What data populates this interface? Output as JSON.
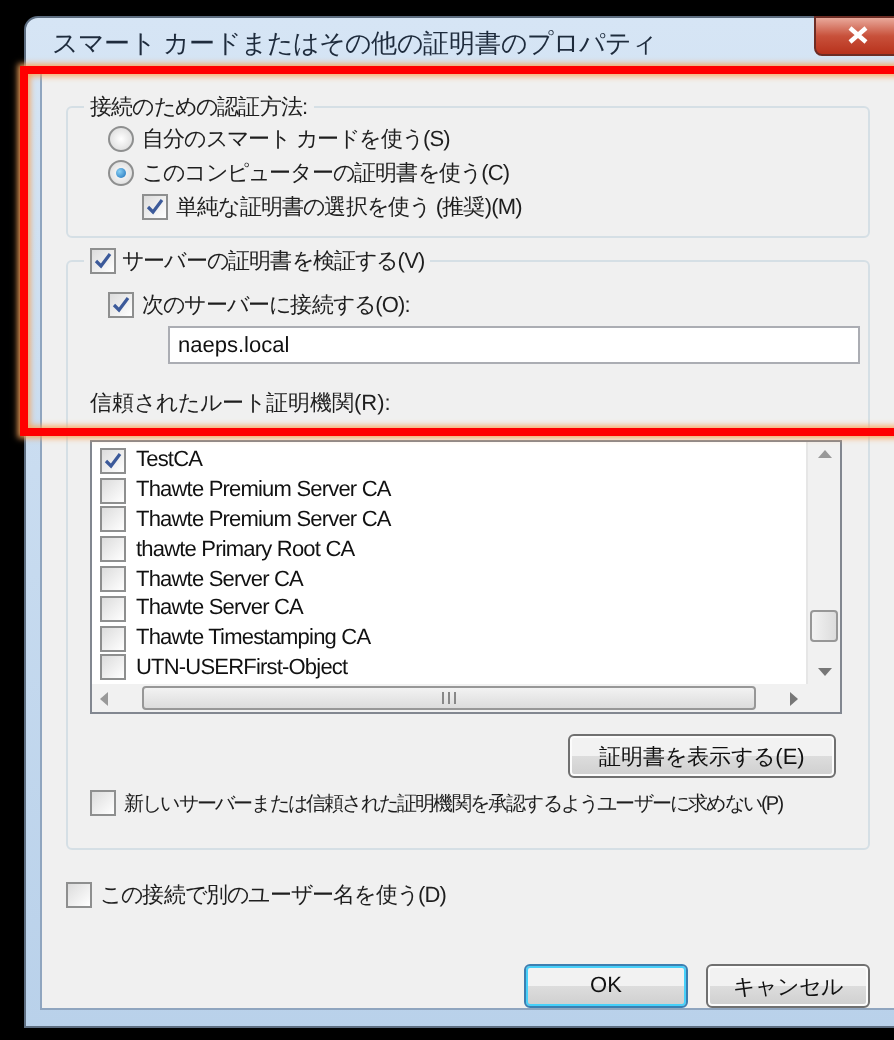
{
  "window": {
    "title": "スマート カードまたはその他の証明書のプロパティ"
  },
  "auth_group": {
    "title": "接続のための認証方法:",
    "options": [
      {
        "label": "自分のスマート カードを使う(S)",
        "selected": false
      },
      {
        "label": "このコンピューターの証明書を使う(C)",
        "selected": true
      }
    ],
    "simple_selection": {
      "label": "単純な証明書の選択を使う (推奨)(M)",
      "checked": true
    }
  },
  "verify": {
    "label": "サーバーの証明書を検証する(V)",
    "checked": true,
    "connect": {
      "label": "次のサーバーに接続する(O):",
      "checked": true,
      "value": "naeps.local"
    },
    "roots_label": "信頼されたルート証明機関(R):",
    "roots": [
      {
        "name": "TestCA",
        "checked": true
      },
      {
        "name": "Thawte Premium Server CA",
        "checked": false
      },
      {
        "name": "Thawte Premium Server CA",
        "checked": false
      },
      {
        "name": "thawte Primary Root CA",
        "checked": false
      },
      {
        "name": "Thawte Server CA",
        "checked": false
      },
      {
        "name": "Thawte Server CA",
        "checked": false
      },
      {
        "name": "Thawte Timestamping CA",
        "checked": false
      },
      {
        "name": "UTN-USERFirst-Object",
        "checked": false
      }
    ],
    "view_button": "証明書を表示する(E)",
    "no_prompt": {
      "label": "新しいサーバーまたは信頼された証明機関を承認するようユーザーに求めない(P)",
      "checked": false
    }
  },
  "other_user": {
    "label": "この接続で別のユーザー名を使う(D)",
    "checked": false
  },
  "buttons": [
    {
      "label": "OK",
      "default": true
    },
    {
      "label": "キャンセル",
      "default": false
    }
  ]
}
